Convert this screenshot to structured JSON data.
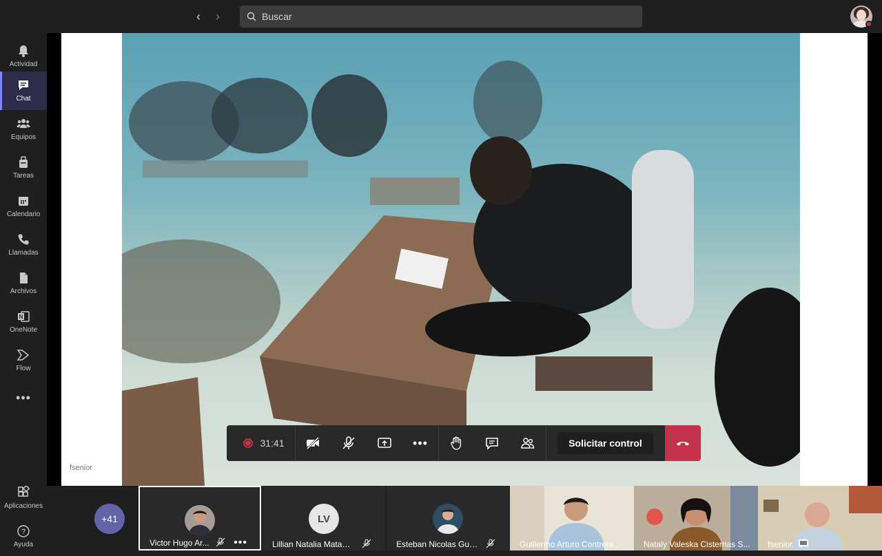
{
  "search": {
    "placeholder": "Buscar"
  },
  "rail": {
    "items": [
      {
        "label": "Actividad"
      },
      {
        "label": "Chat"
      },
      {
        "label": "Equipos"
      },
      {
        "label": "Tareas"
      },
      {
        "label": "Calendario"
      },
      {
        "label": "Llamadas"
      },
      {
        "label": "Archivos"
      },
      {
        "label": "OneNote"
      },
      {
        "label": "Flow"
      }
    ],
    "apps_label": "Aplicaciones",
    "help_label": "Ayuda"
  },
  "meeting": {
    "timer": "31:41",
    "request_control": "Solicitar control",
    "presenter_label": "fsenior",
    "overflow_count": "+41"
  },
  "participants": [
    {
      "name": "Victor Hugo Ar...",
      "initials": ""
    },
    {
      "name": "Lillian Natalia Matam...",
      "initials": "LV"
    },
    {
      "name": "Esteban Nicolas Guz...",
      "initials": ""
    },
    {
      "name": "Guillermo Arturo Contrera..."
    },
    {
      "name": "Nataly Valeska Cisternas S..."
    },
    {
      "name": "fsenior"
    }
  ],
  "colors": {
    "accent": "#6264a7",
    "hangup": "#c4314b",
    "active_rail": "#7f85f5"
  }
}
